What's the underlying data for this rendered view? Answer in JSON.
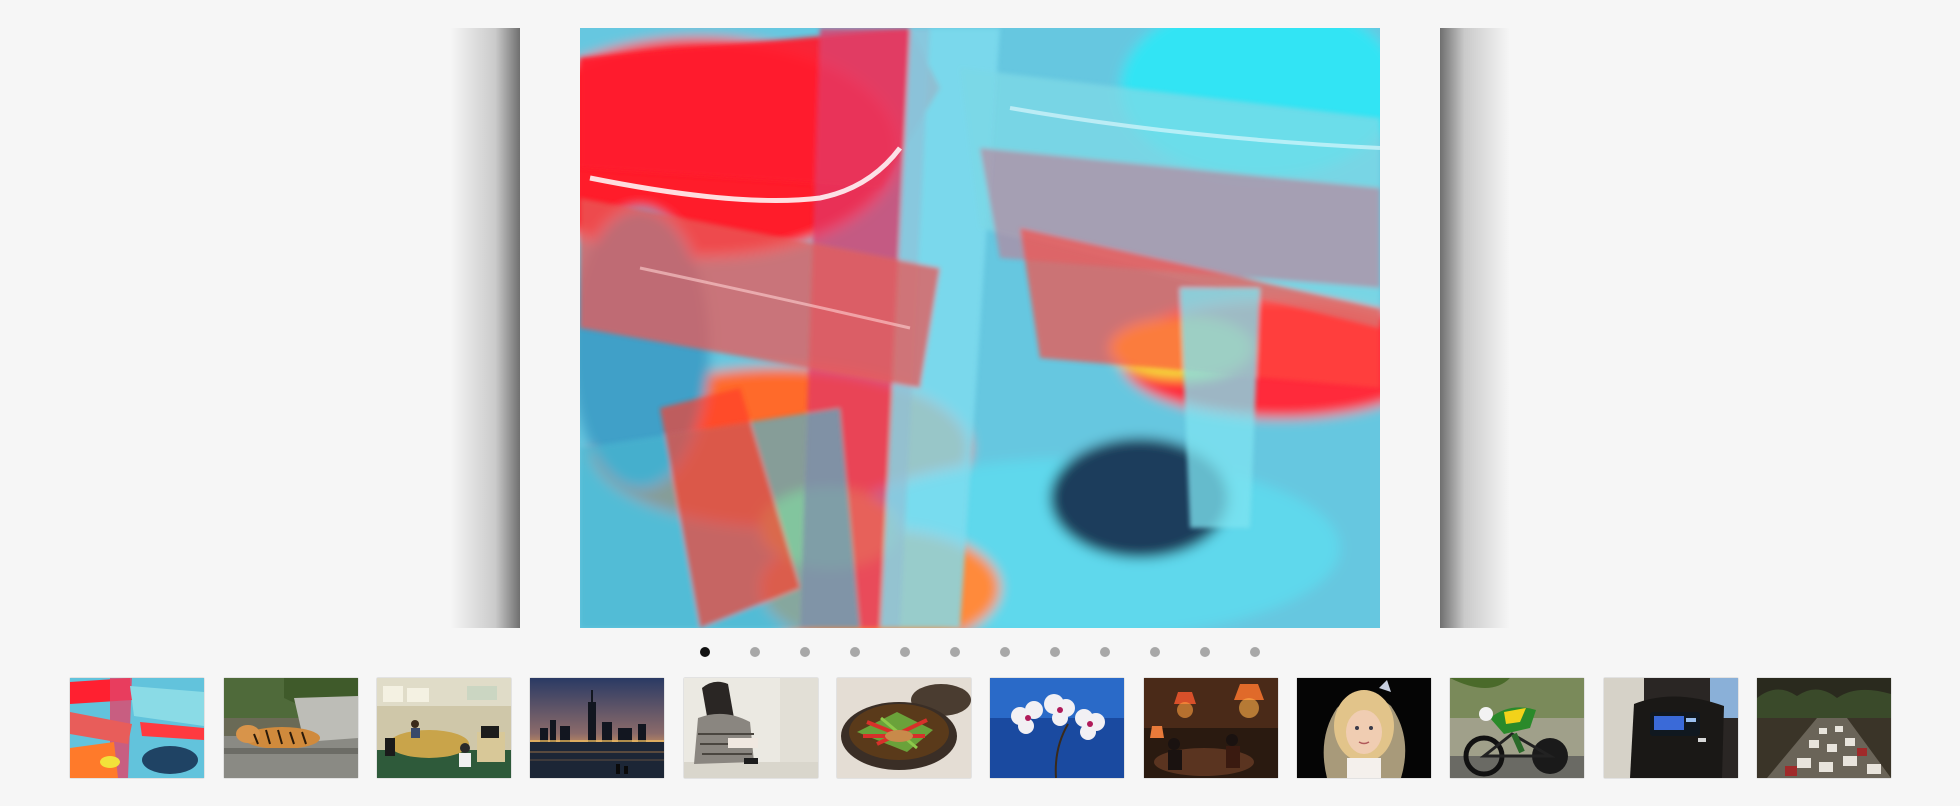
{
  "gallery": {
    "active_index": 0,
    "main_image": {
      "icon": "abstract-paint-image"
    },
    "dots": [
      {
        "active": true
      },
      {
        "active": false
      },
      {
        "active": false
      },
      {
        "active": false
      },
      {
        "active": false
      },
      {
        "active": false
      },
      {
        "active": false
      },
      {
        "active": false
      },
      {
        "active": false
      },
      {
        "active": false
      },
      {
        "active": false
      },
      {
        "active": false
      }
    ],
    "thumbnails": [
      {
        "icon": "abstract-paint-thumbnail"
      },
      {
        "icon": "tiger-thumbnail"
      },
      {
        "icon": "office-thumbnail"
      },
      {
        "icon": "city-skyline-thumbnail"
      },
      {
        "icon": "seated-woman-thumbnail"
      },
      {
        "icon": "food-bowl-thumbnail"
      },
      {
        "icon": "orchid-thumbnail"
      },
      {
        "icon": "restaurant-thumbnail"
      },
      {
        "icon": "girl-portrait-thumbnail"
      },
      {
        "icon": "cyclist-thumbnail"
      },
      {
        "icon": "music-player-thumbnail"
      },
      {
        "icon": "traffic-thumbnail"
      }
    ]
  }
}
